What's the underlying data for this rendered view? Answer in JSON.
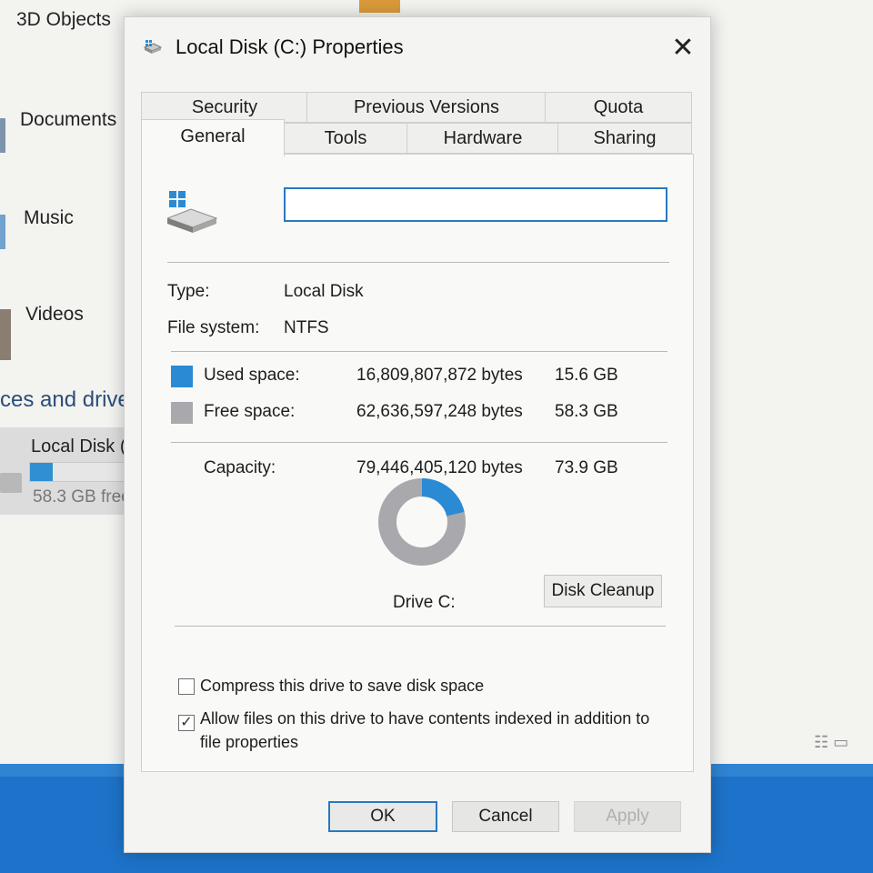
{
  "explorer": {
    "nav_items": [
      "3D Objects",
      "Documents",
      "Music",
      "Videos"
    ],
    "section_heading": "ces and drive",
    "drive_tile": {
      "label": "Local Disk (C",
      "free_text": "58.3 GB free",
      "used_fraction": 0.21
    }
  },
  "dialog": {
    "title": "Local Disk (C:) Properties",
    "close_symbol": "✕",
    "tabs_row1": [
      "Security",
      "Previous Versions",
      "Quota"
    ],
    "tabs_row2": [
      "General",
      "Tools",
      "Hardware",
      "Sharing"
    ],
    "active_tab": "General",
    "name_value": "",
    "type_label": "Type:",
    "type_value": "Local Disk",
    "fs_label": "File system:",
    "fs_value": "NTFS",
    "used": {
      "label": "Used space:",
      "bytes": "16,809,807,872 bytes",
      "size": "15.6 GB",
      "color": "#2a8ad4"
    },
    "free": {
      "label": "Free space:",
      "bytes": "62,636,597,248 bytes",
      "size": "58.3 GB",
      "color": "#a8a8ad"
    },
    "capacity": {
      "label": "Capacity:",
      "bytes": "79,446,405,120 bytes",
      "size": "73.9 GB"
    },
    "used_fraction": 0.212,
    "drive_label": "Drive C:",
    "cleanup_button": "Disk Cleanup",
    "compress": {
      "label": "Compress this drive to save disk space",
      "checked": false
    },
    "index": {
      "label_line1": "Allow files on this drive to have contents indexed in addition to",
      "label_line2": "file properties",
      "checked": true
    },
    "buttons": {
      "ok": "OK",
      "cancel": "Cancel",
      "apply": "Apply"
    }
  }
}
